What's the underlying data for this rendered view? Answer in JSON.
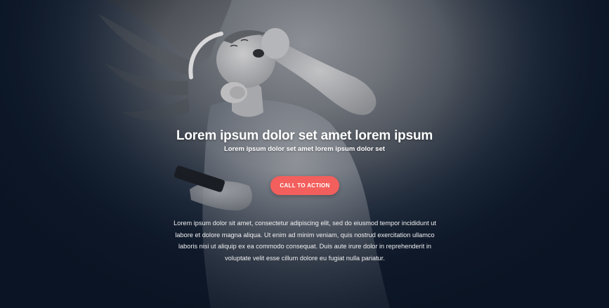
{
  "hero": {
    "headline": "Lorem ipsum dolor set amet lorem ipsum",
    "subheadline": "Lorem ipsum dolor set amet lorem ipsum dolor set",
    "cta_label": "CALL TO ACTION",
    "body": "Lorem ipsum dolor sit amet, consectetur adipiscing elit, sed do eiusmod tempor incididunt ut labore et dolore magna aliqua. Ut enim ad minim veniam, quis nostrud exercitation ullamco laboris nisi ut aliquip ex ea commodo consequat. Duis aute irure dolor in reprehenderit in voluptate velit esse cillum dolore eu fugiat nulla pariatur.",
    "image": "woman-with-headphones-dancing-photo"
  },
  "colors": {
    "cta_background": "#f25f5c",
    "background_dark": "#0c1626",
    "text": "#ffffff"
  }
}
